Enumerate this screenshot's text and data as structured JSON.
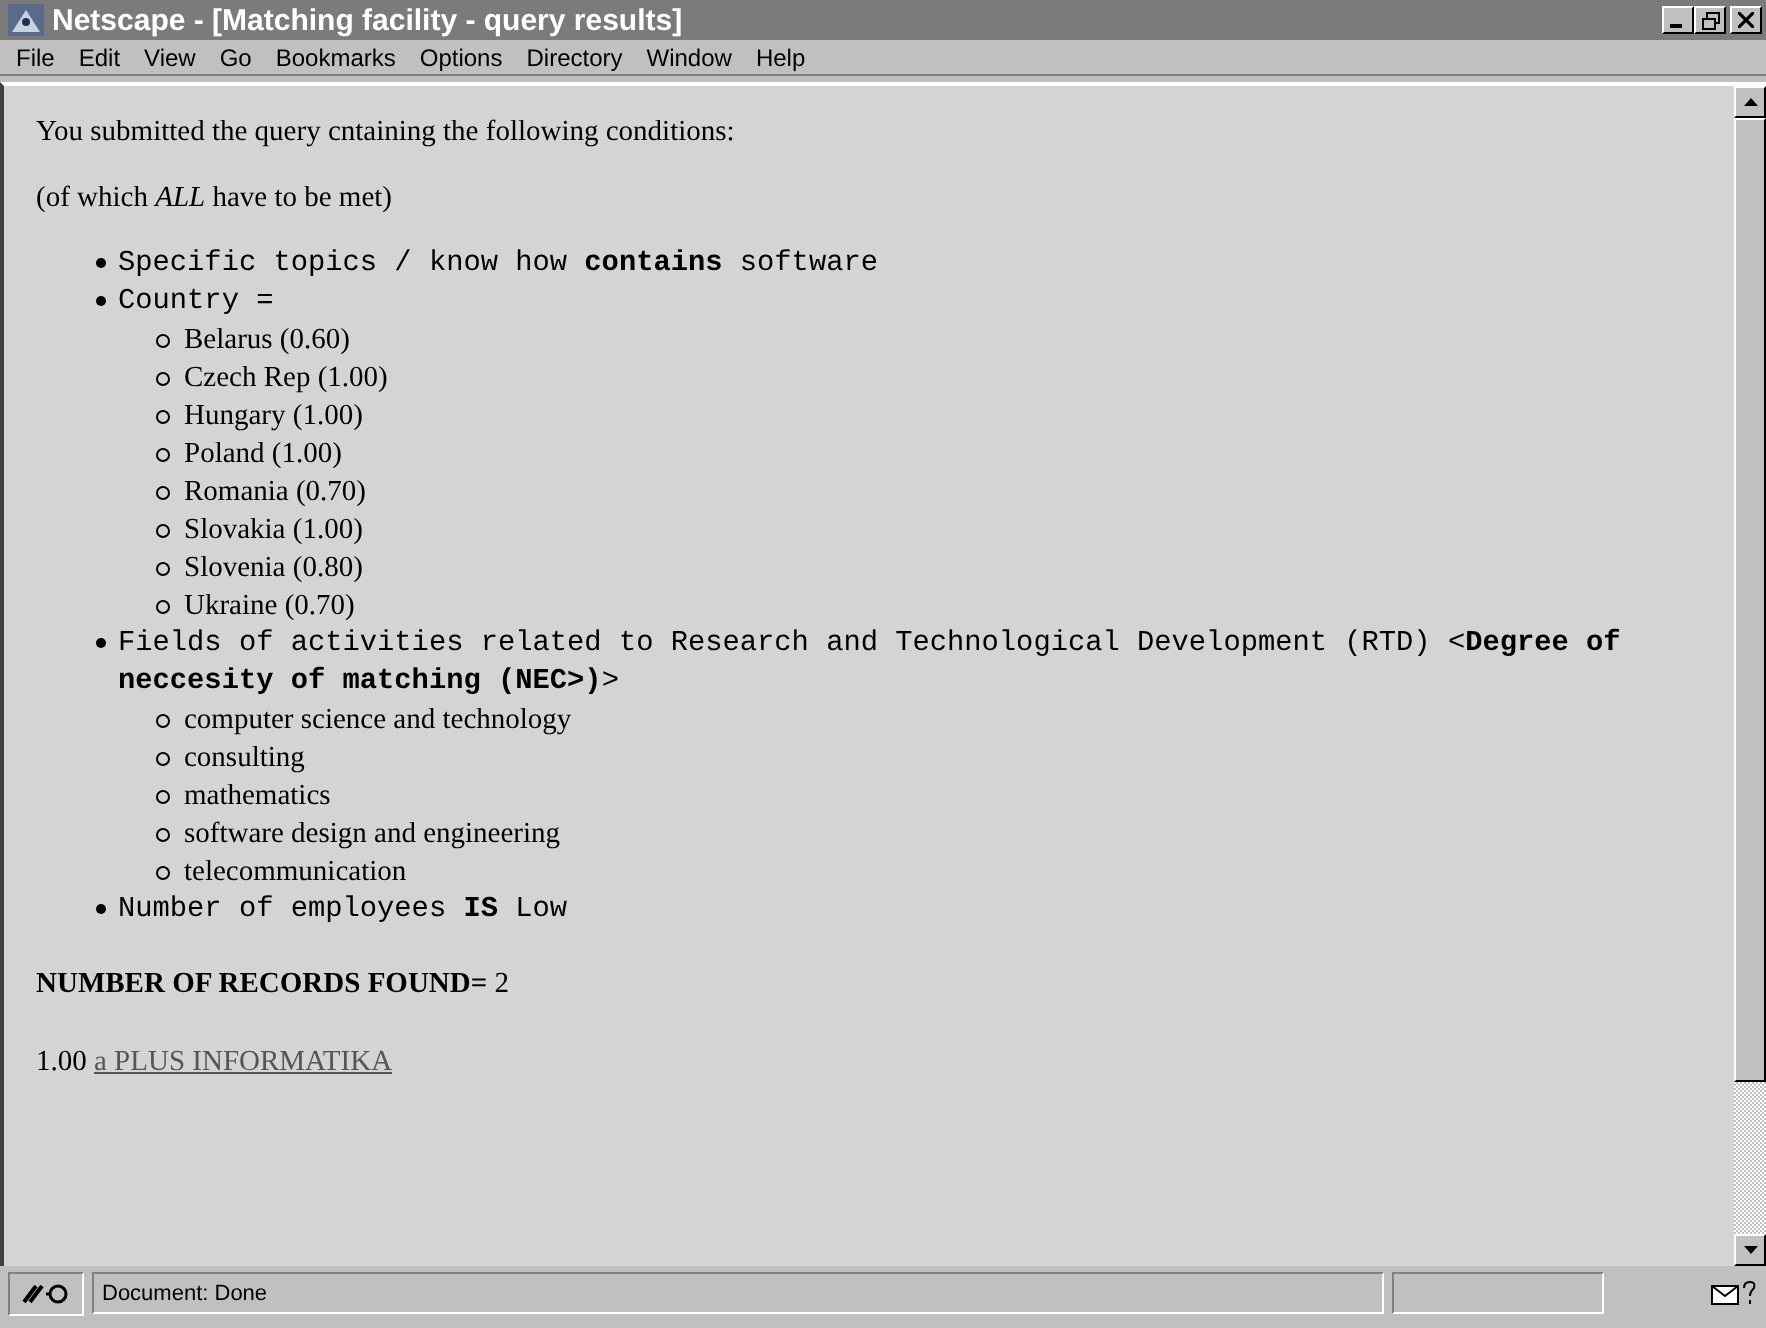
{
  "window": {
    "title": "Netscape - [Matching facility - query results]"
  },
  "menu": [
    "File",
    "Edit",
    "View",
    "Go",
    "Bookmarks",
    "Options",
    "Directory",
    "Window",
    "Help"
  ],
  "intro": "You submitted the query cntaining the following conditions:",
  "note": "(of which *ALL* have to be met)",
  "conditions": [
    {
      "text": "Specific topics / know how **contains** software"
    },
    {
      "text": "Country =",
      "children": [
        "Belarus (0.60)",
        "Czech Rep (1.00)",
        "Hungary (1.00)",
        "Poland (1.00)",
        "Romania (0.70)",
        "Slovakia (1.00)",
        "Slovenia (0.80)",
        "Ukraine (0.70)"
      ]
    },
    {
      "text": "Fields of activities related to Research and Technological Development (RTD) <**Degree of neccesity of matching (NEC>)**>",
      "children": [
        "computer science and technology",
        "consulting",
        "mathematics",
        "software design and engineering",
        "telecommunication"
      ]
    },
    {
      "text": "Number of employees **IS** Low"
    }
  ],
  "records_heading": "**NUMBER OF RECORDS FOUND=** 2",
  "results": [
    {
      "score": "1.00",
      "name": "a PLUS INFORMATIKA"
    }
  ],
  "status_bar": {
    "text": "Document: Done"
  }
}
